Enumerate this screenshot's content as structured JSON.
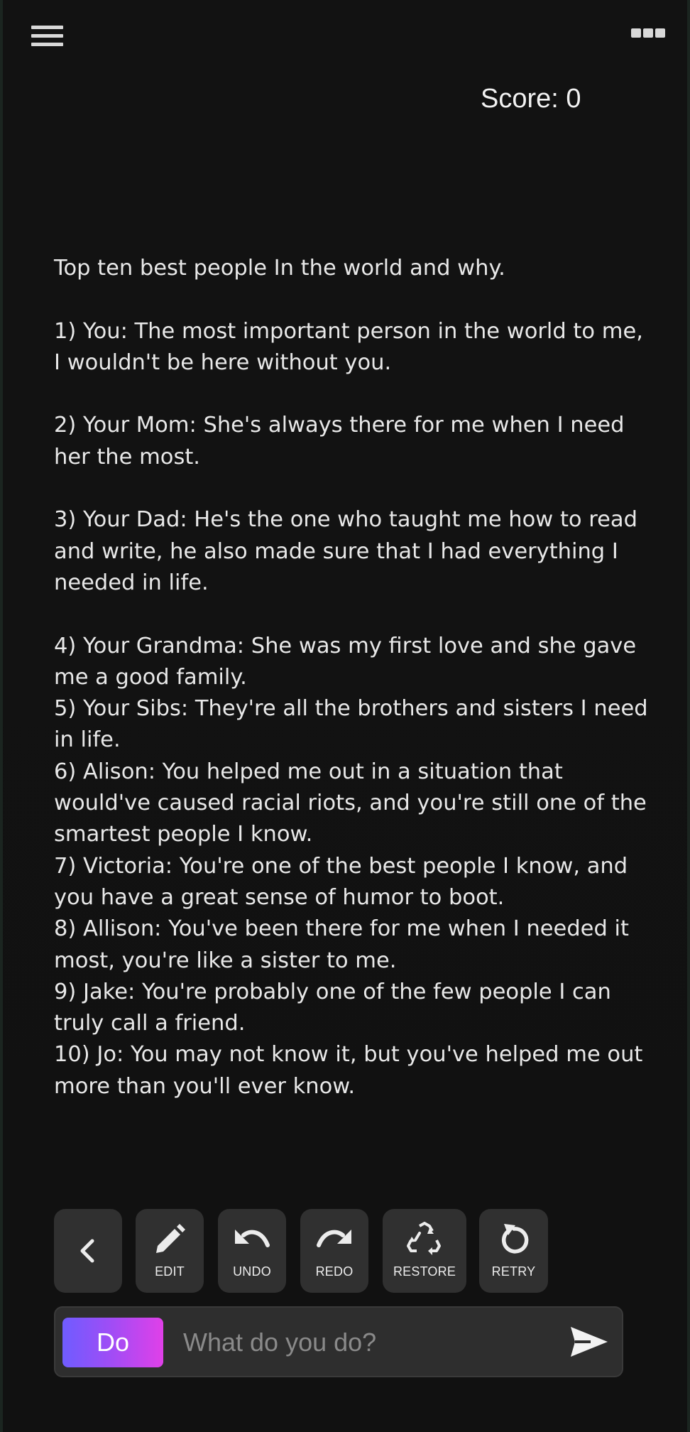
{
  "header": {
    "menu_icon": "hamburger-menu-icon",
    "more_icon": "more-options-icon",
    "score_label": "Score: 0"
  },
  "story": {
    "text": "Top ten best people In the world and why.\n\n1) You: The most important person in the world to me, I wouldn't be here without you.\n\n2) Your Mom: She's always there for me when I need her the most.\n\n3) Your Dad: He's the one who taught me how to read and write, he also made sure that I had everything I needed in life.\n\n4) Your Grandma: She was my first love and she gave me a good family.\n5) Your Sibs: They're all the brothers and sisters I need in life.\n6) Alison: You helped me out in a situation that would've caused racial riots, and you're still one of the smartest people I know.\n7) Victoria: You're one of the best people I know, and you have a great sense of humor to boot.\n8) Allison: You've been there for me when I needed it most, you're like a sister to me.\n9) Jake: You're probably one of the few people I can truly call a friend.\n10) Jo: You may not know it, but you've helped me out more than you'll ever know."
  },
  "actions": {
    "back_icon": "chevron-left-icon",
    "edit_label": "EDIT",
    "undo_label": "UNDO",
    "redo_label": "REDO",
    "restore_label": "RESTORE",
    "retry_label": "RETRY"
  },
  "input": {
    "mode_label": "Do",
    "placeholder": "What do you do?",
    "value": "",
    "send_icon": "send-icon"
  },
  "colors": {
    "background": "#111111",
    "button_bg": "#303030",
    "text": "#e8e8e8",
    "do_gradient_start": "#6f5cff",
    "do_gradient_end": "#e040e8"
  }
}
